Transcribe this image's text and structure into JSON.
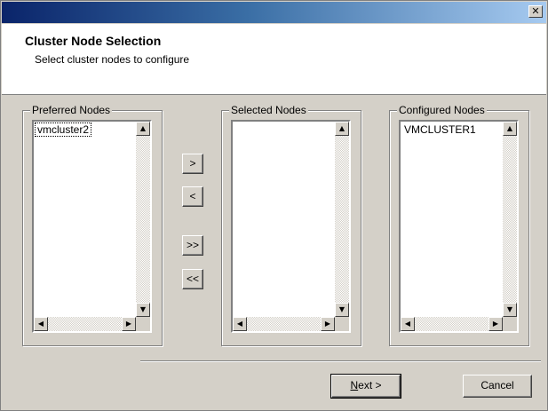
{
  "window": {
    "close_glyph": "✕"
  },
  "header": {
    "title": "Cluster Node Selection",
    "subtitle": "Select cluster nodes to configure"
  },
  "panels": {
    "preferred": {
      "label": "Preferred Nodes",
      "items": [
        "vmcluster2"
      ]
    },
    "selected": {
      "label": "Selected Nodes",
      "items": []
    },
    "configured": {
      "label": "Configured Nodes",
      "items": [
        "VMCLUSTER1"
      ]
    }
  },
  "transfer_buttons": {
    "add": ">",
    "remove": "<",
    "add_all": ">>",
    "remove_all": "<<"
  },
  "buttons": {
    "next_mnemonic": "N",
    "next_rest": "ext >",
    "cancel": "Cancel"
  },
  "icons": {
    "scroll_up": "▲",
    "scroll_down": "▼",
    "scroll_left": "◀",
    "scroll_right": "▶"
  }
}
